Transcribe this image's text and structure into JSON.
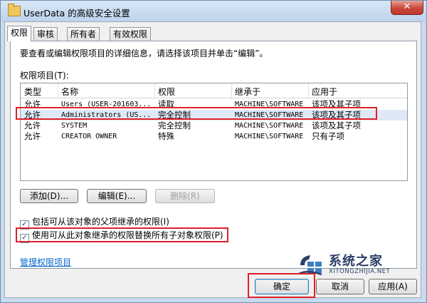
{
  "window": {
    "title": "UserData 的高级安全设置",
    "close_symbol": "✕"
  },
  "tabs": [
    {
      "label": "权限",
      "active": true
    },
    {
      "label": "审核",
      "active": false
    },
    {
      "label": "所有者",
      "active": false
    },
    {
      "label": "有效权限",
      "active": false
    }
  ],
  "permissions": {
    "instruction": "要查看或编辑权限项目的详细信息，请选择该项目并单击“编辑”。",
    "list_label": "权限项目(T):",
    "columns": [
      "类型",
      "名称",
      "权限",
      "继承于",
      "应用于"
    ],
    "rows": [
      {
        "type": "允许",
        "name": "Users (USER-201603...",
        "permission": "读取",
        "inherited_from": "MACHINE\\SOFTWARE",
        "applies_to": "该项及其子项"
      },
      {
        "type": "允许",
        "name": "Administrators (US...",
        "permission": "完全控制",
        "inherited_from": "MACHINE\\SOFTWARE",
        "applies_to": "该项及其子项"
      },
      {
        "type": "允许",
        "name": "SYSTEM",
        "permission": "完全控制",
        "inherited_from": "MACHINE\\SOFTWARE",
        "applies_to": "该项及其子项"
      },
      {
        "type": "允许",
        "name": "CREATOR OWNER",
        "permission": "特殊",
        "inherited_from": "MACHINE\\SOFTWARE",
        "applies_to": "只有子项"
      }
    ],
    "buttons": {
      "add": "添加(D)...",
      "edit": "编辑(E)...",
      "remove": "删除(R)"
    },
    "inherit_checkbox": {
      "label": "包括可从该对象的父项继承的权限(I)",
      "checked": true
    },
    "replace_checkbox": {
      "label": "使用可从此对象继承的权限替换所有子对象权限(P)",
      "checked": true
    },
    "manage_link": "管理权限项目"
  },
  "footer": {
    "ok": "确定",
    "cancel": "取消",
    "apply": "应用(A)"
  },
  "watermark": {
    "brand_cn": "系统之家",
    "brand_url": "XITONGZHIJIA.NET"
  },
  "colors": {
    "highlight_box": "#e0202a",
    "link": "#0066cc",
    "selected_row": "#dfe9f6"
  }
}
